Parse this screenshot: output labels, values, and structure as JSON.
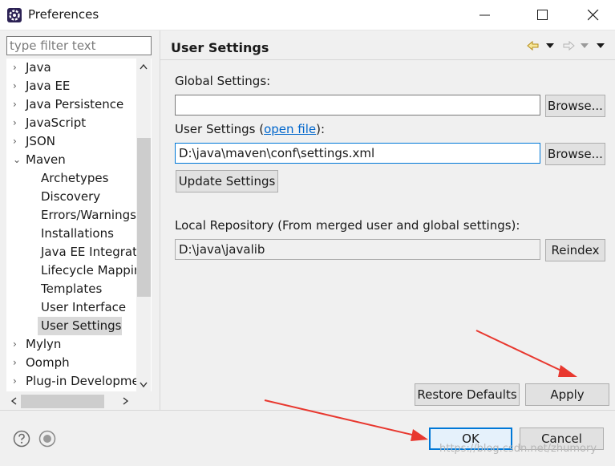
{
  "window": {
    "title": "Preferences",
    "icon": "eclipse-gear-icon"
  },
  "filter": {
    "placeholder": "type filter text"
  },
  "tree": {
    "items": [
      {
        "label": "Java",
        "expander": "›"
      },
      {
        "label": "Java EE",
        "expander": "›"
      },
      {
        "label": "Java Persistence",
        "expander": "›"
      },
      {
        "label": "JavaScript",
        "expander": "›"
      },
      {
        "label": "JSON",
        "expander": "›"
      },
      {
        "label": "Maven",
        "expander": "⌄"
      },
      {
        "label": "Archetypes"
      },
      {
        "label": "Discovery"
      },
      {
        "label": "Errors/Warnings"
      },
      {
        "label": "Installations"
      },
      {
        "label": "Java EE Integrati"
      },
      {
        "label": "Lifecycle Mappin"
      },
      {
        "label": "Templates"
      },
      {
        "label": "User Interface"
      },
      {
        "label": "User Settings"
      },
      {
        "label": "Mylyn",
        "expander": "›"
      },
      {
        "label": "Oomph",
        "expander": "›"
      },
      {
        "label": "Plug-in Developme",
        "expander": "›"
      }
    ]
  },
  "page": {
    "title": "User Settings",
    "global_label": "Global Settings:",
    "global_value": "",
    "browse_label": "Browse...",
    "user_label_prefix": "User Settings (",
    "open_file_link": "open file",
    "user_label_suffix": "):",
    "user_value": "D:\\java\\maven\\conf\\settings.xml",
    "update_label": "Update Settings",
    "local_repo_label": "Local Repository (From merged user and global settings):",
    "local_repo_value": "D:\\java\\javalib",
    "reindex_label": "Reindex",
    "restore_label": "Restore Defaults",
    "apply_label": "Apply"
  },
  "footer": {
    "ok_label": "OK",
    "cancel_label": "Cancel"
  },
  "watermark": "https://blog.csdn.net/zhumory",
  "colors": {
    "accent": "#0078d7",
    "arrow": "#e8382f",
    "link": "#0066cc"
  }
}
